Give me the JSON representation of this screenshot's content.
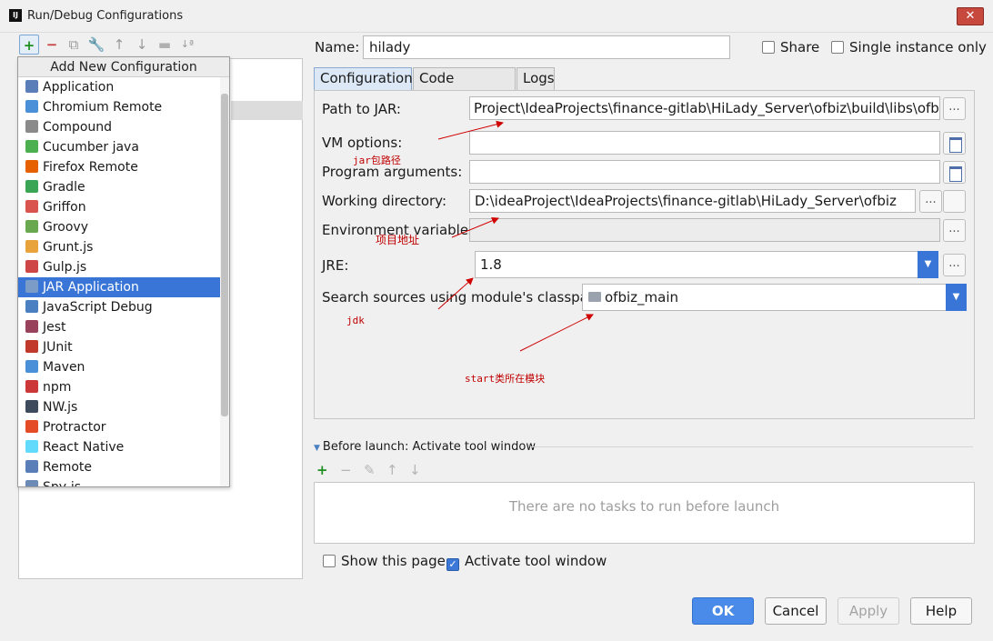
{
  "window": {
    "title": "Run/Debug Configurations",
    "app_icon": "IJ",
    "close_glyph": "✕"
  },
  "toolbar": {
    "add": "+",
    "remove": "−",
    "copy": "⧉",
    "edit": "🔧",
    "up": "↑",
    "down": "↓",
    "folder": "▬",
    "sort": "↓ª"
  },
  "popup": {
    "title": "Add New Configuration",
    "items": [
      {
        "label": "Application",
        "icon": "application-icon",
        "color": "#5a7fb8"
      },
      {
        "label": "Chromium Remote",
        "icon": "chromium-icon",
        "color": "#4a90d9"
      },
      {
        "label": "Compound",
        "icon": "compound-icon",
        "color": "#8a8a8a"
      },
      {
        "label": "Cucumber java",
        "icon": "cucumber-icon",
        "color": "#4caf50"
      },
      {
        "label": "Firefox Remote",
        "icon": "firefox-icon",
        "color": "#e66000"
      },
      {
        "label": "Gradle",
        "icon": "gradle-icon",
        "color": "#3aa655"
      },
      {
        "label": "Griffon",
        "icon": "griffon-icon",
        "color": "#d9534f"
      },
      {
        "label": "Groovy",
        "icon": "groovy-icon",
        "color": "#6aa84f"
      },
      {
        "label": "Grunt.js",
        "icon": "grunt-icon",
        "color": "#e8a33b"
      },
      {
        "label": "Gulp.js",
        "icon": "gulp-icon",
        "color": "#cf4647"
      },
      {
        "label": "JAR Application",
        "icon": "jar-icon",
        "color": "#7a9cc6",
        "selected": true
      },
      {
        "label": "JavaScript Debug",
        "icon": "js-debug-icon",
        "color": "#4a7fc1"
      },
      {
        "label": "Jest",
        "icon": "jest-icon",
        "color": "#99425b"
      },
      {
        "label": "JUnit",
        "icon": "junit-icon",
        "color": "#c0392b"
      },
      {
        "label": "Maven",
        "icon": "maven-icon",
        "color": "#4a90d9"
      },
      {
        "label": "npm",
        "icon": "npm-icon",
        "color": "#cb3837"
      },
      {
        "label": "NW.js",
        "icon": "nwjs-icon",
        "color": "#3d4b5c"
      },
      {
        "label": "Protractor",
        "icon": "protractor-icon",
        "color": "#e34c26"
      },
      {
        "label": "React Native",
        "icon": "react-icon",
        "color": "#61dafb"
      },
      {
        "label": "Remote",
        "icon": "remote-icon",
        "color": "#5a7fb8"
      },
      {
        "label": "Spy-js",
        "icon": "spyjs-icon",
        "color": "#6b8ab5"
      }
    ]
  },
  "form": {
    "name_label": "Name:",
    "name_value": "hilady",
    "share_label": "Share",
    "share_checked": false,
    "single_label": "Single instance only",
    "single_checked": false
  },
  "tabs": [
    "Configuration",
    "Code Coverage",
    "Logs"
  ],
  "config": {
    "path_label": "Path to JAR:",
    "path_value": "Project\\IdeaProjects\\finance-gitlab\\HiLady_Server\\ofbiz\\build\\libs\\ofbiz.jar",
    "vm_label": "VM options:",
    "vm_value": "",
    "args_label": "Program arguments:",
    "args_value": "",
    "wd_label": "Working directory:",
    "wd_value": "D:\\ideaProject\\IdeaProjects\\finance-gitlab\\HiLady_Server\\ofbiz",
    "env_label": "Environment variables:",
    "env_value": "",
    "jre_label": "JRE:",
    "jre_value": "1.8",
    "cp_label": "Search sources using module's classpath:",
    "cp_value": "ofbiz_main",
    "dots": "..."
  },
  "annotations": {
    "jar": "jar包路径",
    "project": "项目地址",
    "jdk": "jdk",
    "start": "start类所在模块",
    "arrow_color": "#d00000"
  },
  "before_launch": {
    "title": "Before launch: Activate tool window",
    "empty": "There are no tasks to run before launch",
    "add": "+",
    "remove": "−",
    "edit": "✎",
    "up": "↑",
    "down": "↓"
  },
  "bottom": {
    "show_page_label": "Show this page",
    "show_page_checked": false,
    "activate_label": "Activate tool window",
    "activate_checked": true
  },
  "buttons": {
    "ok": "OK",
    "cancel": "Cancel",
    "apply": "Apply",
    "help": "Help"
  }
}
